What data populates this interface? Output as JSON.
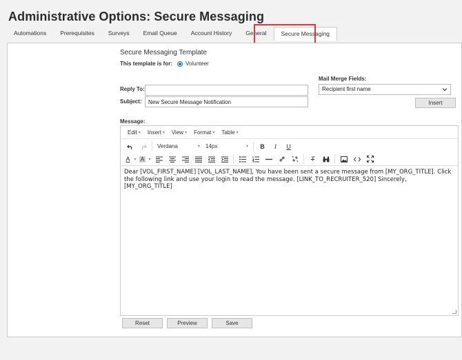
{
  "page_title": "Administrative Options: Secure Messaging",
  "tabs": [
    {
      "label": "Automations",
      "active": false
    },
    {
      "label": "Prerequisites",
      "active": false
    },
    {
      "label": "Surveys",
      "active": false
    },
    {
      "label": "Email Queue",
      "active": false
    },
    {
      "label": "Account History",
      "active": false
    },
    {
      "label": "General",
      "active": false
    },
    {
      "label": "Secure Messaging",
      "active": true
    }
  ],
  "section_title": "Secure Messaging Template",
  "template_for": {
    "label": "This template is for:",
    "option": "Volunteer",
    "selected": true
  },
  "reply_to": {
    "label": "Reply To:",
    "value": ""
  },
  "subject": {
    "label": "Subject:",
    "value": "New Secure Message Notification"
  },
  "mail_merge": {
    "label": "Mail Merge Fields:",
    "selected": "Recipient first name",
    "insert_label": "Insert"
  },
  "message_label": "Message:",
  "editor": {
    "menus": [
      "Edit",
      "Insert",
      "View",
      "Format",
      "Table"
    ],
    "font_family": "Verdana",
    "font_size": "14px",
    "body": "Dear [VOL_FIRST_NAME] [VOL_LAST_NAME], You have been sent a secure message from [MY_ORG_TITLE]. Click the following link and use your login to read the message. [LINK_TO_RECRUITER_520] Sincerely, [MY_ORG_TITLE]"
  },
  "buttons": {
    "reset": "Reset",
    "preview": "Preview",
    "save": "Save"
  },
  "colors": {
    "accent": "#1a73e8",
    "highlight": "#d9363e"
  }
}
